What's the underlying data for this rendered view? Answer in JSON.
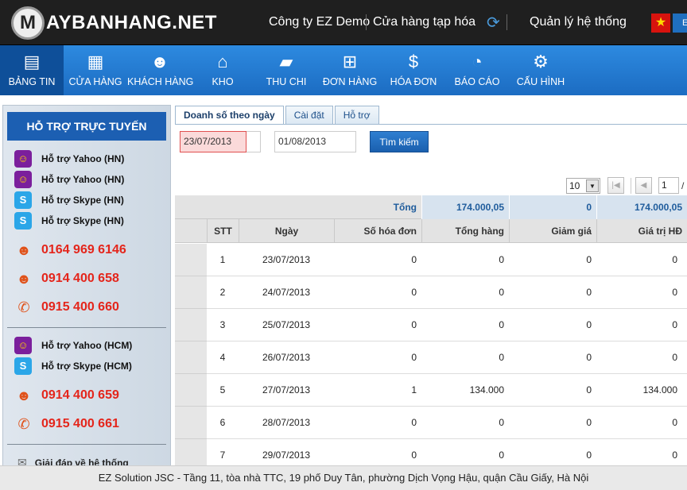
{
  "header": {
    "logo_letter": "M",
    "logo_text": "AYBANHANG.NET",
    "company": "Công ty EZ Demo",
    "store": "Cửa hàng tạp hóa",
    "sync_icon": "refresh-icon",
    "admin": "Quản lý hệ thống",
    "flag_icon": "vietnam-flag-icon",
    "lang_label": "E"
  },
  "nav": {
    "items": [
      {
        "label": "BẢNG TIN",
        "icon": "dashboard-icon"
      },
      {
        "label": "CỬA HÀNG",
        "icon": "store-icon"
      },
      {
        "label": "KHÁCH HÀNG",
        "icon": "customers-icon"
      },
      {
        "label": "KHO",
        "icon": "warehouse-icon"
      },
      {
        "label": "THU CHI",
        "icon": "money-icon"
      },
      {
        "label": "ĐƠN HÀNG",
        "icon": "cart-icon"
      },
      {
        "label": "HÓA ĐƠN",
        "icon": "invoice-icon"
      },
      {
        "label": "BÁO CÁO",
        "icon": "report-icon"
      },
      {
        "label": "CẤU HÌNH",
        "icon": "settings-icon"
      }
    ]
  },
  "sidebar": {
    "title": "HỖ TRỢ TRỰC TUYẾN",
    "hn_support": [
      {
        "label": "Hỗ trợ Yahoo (HN)",
        "icon": "yahoo-icon"
      },
      {
        "label": "Hỗ trợ Yahoo (HN)",
        "icon": "yahoo-icon"
      },
      {
        "label": "Hỗ trợ Skype (HN)",
        "icon": "skype-icon"
      },
      {
        "label": "Hỗ trợ Skype (HN)",
        "icon": "skype-icon"
      }
    ],
    "hn_phones": [
      "0164 969 6146",
      "0914 400 658",
      "0915 400 660"
    ],
    "hcm_support": [
      {
        "label": "Hỗ trợ Yahoo (HCM)",
        "icon": "yahoo-icon"
      },
      {
        "label": "Hỗ trợ Skype (HCM)",
        "icon": "skype-icon"
      }
    ],
    "hcm_phones": [
      "0914 400 659",
      "0915 400 661"
    ],
    "bottom_link": "Giải đáp về hệ thống"
  },
  "tabs": [
    "Doanh số theo ngày",
    "Cài đặt",
    "Hỗ trợ"
  ],
  "filter": {
    "date_from": "23/07/2013",
    "date_to": "01/08/2013",
    "search_label": "Tìm kiếm"
  },
  "pager": {
    "page_size": "10",
    "current_page": "1",
    "total_pages": "/"
  },
  "grid": {
    "summary": {
      "label": "Tổng",
      "total_goods": "174.000,05",
      "discount": "0",
      "invoice_value": "174.000,05"
    },
    "columns": [
      "STT",
      "Ngày",
      "Số hóa đơn",
      "Tổng hàng",
      "Giảm giá",
      "Giá trị HĐ"
    ],
    "rows": [
      {
        "stt": "1",
        "date": "23/07/2013",
        "invoices": "0",
        "goods": "0",
        "discount": "0",
        "value": "0"
      },
      {
        "stt": "2",
        "date": "24/07/2013",
        "invoices": "0",
        "goods": "0",
        "discount": "0",
        "value": "0"
      },
      {
        "stt": "3",
        "date": "25/07/2013",
        "invoices": "0",
        "goods": "0",
        "discount": "0",
        "value": "0"
      },
      {
        "stt": "4",
        "date": "26/07/2013",
        "invoices": "0",
        "goods": "0",
        "discount": "0",
        "value": "0"
      },
      {
        "stt": "5",
        "date": "27/07/2013",
        "invoices": "1",
        "goods": "134.000",
        "discount": "0",
        "value": "134.000"
      },
      {
        "stt": "6",
        "date": "28/07/2013",
        "invoices": "0",
        "goods": "0",
        "discount": "0",
        "value": "0"
      },
      {
        "stt": "7",
        "date": "29/07/2013",
        "invoices": "0",
        "goods": "0",
        "discount": "0",
        "value": "0"
      }
    ]
  },
  "footer": {
    "text": "EZ Solution JSC - Tầng 11, tòa nhà TTC, 19 phố Duy Tân, phường Dịch Vọng Hậu, quận Cầu Giấy, Hà Nội"
  }
}
